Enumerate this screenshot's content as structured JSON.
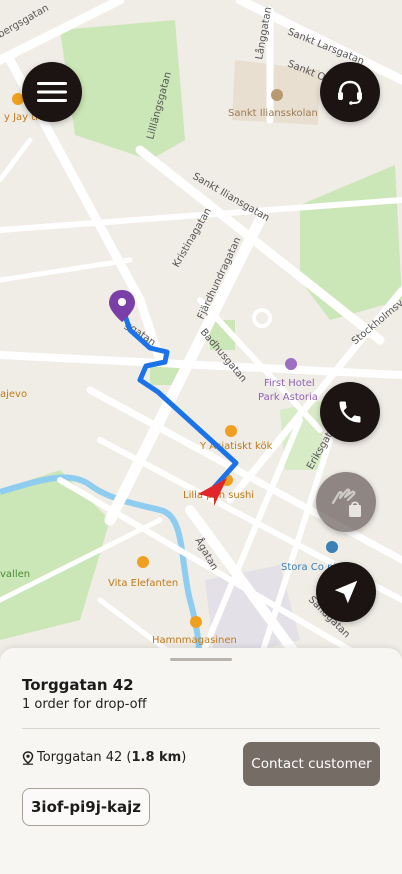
{
  "map": {
    "streets": {
      "bergsgatan": "bergsgatan",
      "sankt_larsgatan": "Sankt Larsgatan",
      "sankt_ol": "Sankt Ol",
      "langgatan": "Långgatan",
      "lillangsgatan": "Lilllängsgatan",
      "sankt_iliansgatan": "Sankt Iliansgatan",
      "kristinagatan": "Kristinagatan",
      "fjardhundragatan": "Fjärdhundragatan",
      "badhusgatan": "Badhusgatan",
      "stockholmsv": "Stockholmsv",
      "torggatan_partial": "ggatan",
      "eriksgatan": "Eriksgatan",
      "agatan": "Ågatan",
      "sandgatan": "Sandgatan"
    },
    "pois": {
      "ray_jay": "y Jay the",
      "sankt_iliansskolan": "Sankt Iliansskolan",
      "first_hotel_1": "First Hotel",
      "first_hotel_2": "Park Astoria",
      "asiatiskt_kok": "Y  Asiatiskt kök",
      "lilla_japan": "Lilla    pan sushi",
      "stora_coffee": "Stora Co        ping",
      "vita_elefanten": "Vita Elefanten",
      "hamnmagasinen": "Hamnmagasinen",
      "evo": "ajevo",
      "vallen": "vallen"
    },
    "colors": {
      "route": "#1a73e8",
      "destination_pin": "#7b3fa8",
      "courier_arrow": "#e0262b",
      "park": "#cbe6b7",
      "water": "#8fcdf0"
    }
  },
  "controls": {
    "menu_icon": "hamburger-menu-icon",
    "support_icon": "headset-icon",
    "call_icon": "phone-icon",
    "handoff_icon": "hand-bag-icon",
    "locate_icon": "navigation-arrow-icon"
  },
  "sheet": {
    "title": "Torggatan 42",
    "subtitle": "1 order for drop-off",
    "address": "Torggatan 42",
    "distance": "1.8 km",
    "contact_button": "Contact customer",
    "order_code": "3iof-pi9j-kajz"
  }
}
